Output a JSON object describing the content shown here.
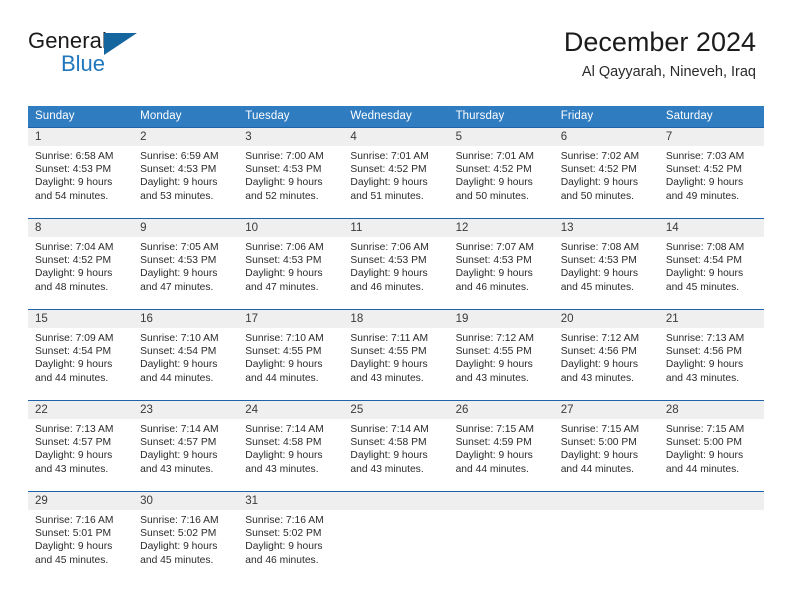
{
  "brand": {
    "word_one": "General",
    "word_two": "Blue",
    "logo_icon": "triangle-logo-icon",
    "accent_color": "#15659e",
    "blue_text_color": "#2077bd"
  },
  "header": {
    "title": "December 2024",
    "subtitle": "Al Qayyarah, Nineveh, Iraq"
  },
  "theme": {
    "header_row_bg": "#2f7cc0",
    "row_divider": "#1f62a8",
    "daynum_bg": "#efefef"
  },
  "calendar": {
    "weekday_headers": [
      "Sunday",
      "Monday",
      "Tuesday",
      "Wednesday",
      "Thursday",
      "Friday",
      "Saturday"
    ],
    "weeks": [
      [
        {
          "day": "1",
          "sunrise": "Sunrise: 6:58 AM",
          "sunset": "Sunset: 4:53 PM",
          "daylight_line1": "Daylight: 9 hours",
          "daylight_line2": "and 54 minutes."
        },
        {
          "day": "2",
          "sunrise": "Sunrise: 6:59 AM",
          "sunset": "Sunset: 4:53 PM",
          "daylight_line1": "Daylight: 9 hours",
          "daylight_line2": "and 53 minutes."
        },
        {
          "day": "3",
          "sunrise": "Sunrise: 7:00 AM",
          "sunset": "Sunset: 4:53 PM",
          "daylight_line1": "Daylight: 9 hours",
          "daylight_line2": "and 52 minutes."
        },
        {
          "day": "4",
          "sunrise": "Sunrise: 7:01 AM",
          "sunset": "Sunset: 4:52 PM",
          "daylight_line1": "Daylight: 9 hours",
          "daylight_line2": "and 51 minutes."
        },
        {
          "day": "5",
          "sunrise": "Sunrise: 7:01 AM",
          "sunset": "Sunset: 4:52 PM",
          "daylight_line1": "Daylight: 9 hours",
          "daylight_line2": "and 50 minutes."
        },
        {
          "day": "6",
          "sunrise": "Sunrise: 7:02 AM",
          "sunset": "Sunset: 4:52 PM",
          "daylight_line1": "Daylight: 9 hours",
          "daylight_line2": "and 50 minutes."
        },
        {
          "day": "7",
          "sunrise": "Sunrise: 7:03 AM",
          "sunset": "Sunset: 4:52 PM",
          "daylight_line1": "Daylight: 9 hours",
          "daylight_line2": "and 49 minutes."
        }
      ],
      [
        {
          "day": "8",
          "sunrise": "Sunrise: 7:04 AM",
          "sunset": "Sunset: 4:52 PM",
          "daylight_line1": "Daylight: 9 hours",
          "daylight_line2": "and 48 minutes."
        },
        {
          "day": "9",
          "sunrise": "Sunrise: 7:05 AM",
          "sunset": "Sunset: 4:53 PM",
          "daylight_line1": "Daylight: 9 hours",
          "daylight_line2": "and 47 minutes."
        },
        {
          "day": "10",
          "sunrise": "Sunrise: 7:06 AM",
          "sunset": "Sunset: 4:53 PM",
          "daylight_line1": "Daylight: 9 hours",
          "daylight_line2": "and 47 minutes."
        },
        {
          "day": "11",
          "sunrise": "Sunrise: 7:06 AM",
          "sunset": "Sunset: 4:53 PM",
          "daylight_line1": "Daylight: 9 hours",
          "daylight_line2": "and 46 minutes."
        },
        {
          "day": "12",
          "sunrise": "Sunrise: 7:07 AM",
          "sunset": "Sunset: 4:53 PM",
          "daylight_line1": "Daylight: 9 hours",
          "daylight_line2": "and 46 minutes."
        },
        {
          "day": "13",
          "sunrise": "Sunrise: 7:08 AM",
          "sunset": "Sunset: 4:53 PM",
          "daylight_line1": "Daylight: 9 hours",
          "daylight_line2": "and 45 minutes."
        },
        {
          "day": "14",
          "sunrise": "Sunrise: 7:08 AM",
          "sunset": "Sunset: 4:54 PM",
          "daylight_line1": "Daylight: 9 hours",
          "daylight_line2": "and 45 minutes."
        }
      ],
      [
        {
          "day": "15",
          "sunrise": "Sunrise: 7:09 AM",
          "sunset": "Sunset: 4:54 PM",
          "daylight_line1": "Daylight: 9 hours",
          "daylight_line2": "and 44 minutes."
        },
        {
          "day": "16",
          "sunrise": "Sunrise: 7:10 AM",
          "sunset": "Sunset: 4:54 PM",
          "daylight_line1": "Daylight: 9 hours",
          "daylight_line2": "and 44 minutes."
        },
        {
          "day": "17",
          "sunrise": "Sunrise: 7:10 AM",
          "sunset": "Sunset: 4:55 PM",
          "daylight_line1": "Daylight: 9 hours",
          "daylight_line2": "and 44 minutes."
        },
        {
          "day": "18",
          "sunrise": "Sunrise: 7:11 AM",
          "sunset": "Sunset: 4:55 PM",
          "daylight_line1": "Daylight: 9 hours",
          "daylight_line2": "and 43 minutes."
        },
        {
          "day": "19",
          "sunrise": "Sunrise: 7:12 AM",
          "sunset": "Sunset: 4:55 PM",
          "daylight_line1": "Daylight: 9 hours",
          "daylight_line2": "and 43 minutes."
        },
        {
          "day": "20",
          "sunrise": "Sunrise: 7:12 AM",
          "sunset": "Sunset: 4:56 PM",
          "daylight_line1": "Daylight: 9 hours",
          "daylight_line2": "and 43 minutes."
        },
        {
          "day": "21",
          "sunrise": "Sunrise: 7:13 AM",
          "sunset": "Sunset: 4:56 PM",
          "daylight_line1": "Daylight: 9 hours",
          "daylight_line2": "and 43 minutes."
        }
      ],
      [
        {
          "day": "22",
          "sunrise": "Sunrise: 7:13 AM",
          "sunset": "Sunset: 4:57 PM",
          "daylight_line1": "Daylight: 9 hours",
          "daylight_line2": "and 43 minutes."
        },
        {
          "day": "23",
          "sunrise": "Sunrise: 7:14 AM",
          "sunset": "Sunset: 4:57 PM",
          "daylight_line1": "Daylight: 9 hours",
          "daylight_line2": "and 43 minutes."
        },
        {
          "day": "24",
          "sunrise": "Sunrise: 7:14 AM",
          "sunset": "Sunset: 4:58 PM",
          "daylight_line1": "Daylight: 9 hours",
          "daylight_line2": "and 43 minutes."
        },
        {
          "day": "25",
          "sunrise": "Sunrise: 7:14 AM",
          "sunset": "Sunset: 4:58 PM",
          "daylight_line1": "Daylight: 9 hours",
          "daylight_line2": "and 43 minutes."
        },
        {
          "day": "26",
          "sunrise": "Sunrise: 7:15 AM",
          "sunset": "Sunset: 4:59 PM",
          "daylight_line1": "Daylight: 9 hours",
          "daylight_line2": "and 44 minutes."
        },
        {
          "day": "27",
          "sunrise": "Sunrise: 7:15 AM",
          "sunset": "Sunset: 5:00 PM",
          "daylight_line1": "Daylight: 9 hours",
          "daylight_line2": "and 44 minutes."
        },
        {
          "day": "28",
          "sunrise": "Sunrise: 7:15 AM",
          "sunset": "Sunset: 5:00 PM",
          "daylight_line1": "Daylight: 9 hours",
          "daylight_line2": "and 44 minutes."
        }
      ],
      [
        {
          "day": "29",
          "sunrise": "Sunrise: 7:16 AM",
          "sunset": "Sunset: 5:01 PM",
          "daylight_line1": "Daylight: 9 hours",
          "daylight_line2": "and 45 minutes."
        },
        {
          "day": "30",
          "sunrise": "Sunrise: 7:16 AM",
          "sunset": "Sunset: 5:02 PM",
          "daylight_line1": "Daylight: 9 hours",
          "daylight_line2": "and 45 minutes."
        },
        {
          "day": "31",
          "sunrise": "Sunrise: 7:16 AM",
          "sunset": "Sunset: 5:02 PM",
          "daylight_line1": "Daylight: 9 hours",
          "daylight_line2": "and 46 minutes."
        },
        {
          "day": "",
          "sunrise": "",
          "sunset": "",
          "daylight_line1": "",
          "daylight_line2": ""
        },
        {
          "day": "",
          "sunrise": "",
          "sunset": "",
          "daylight_line1": "",
          "daylight_line2": ""
        },
        {
          "day": "",
          "sunrise": "",
          "sunset": "",
          "daylight_line1": "",
          "daylight_line2": ""
        },
        {
          "day": "",
          "sunrise": "",
          "sunset": "",
          "daylight_line1": "",
          "daylight_line2": ""
        }
      ]
    ]
  }
}
